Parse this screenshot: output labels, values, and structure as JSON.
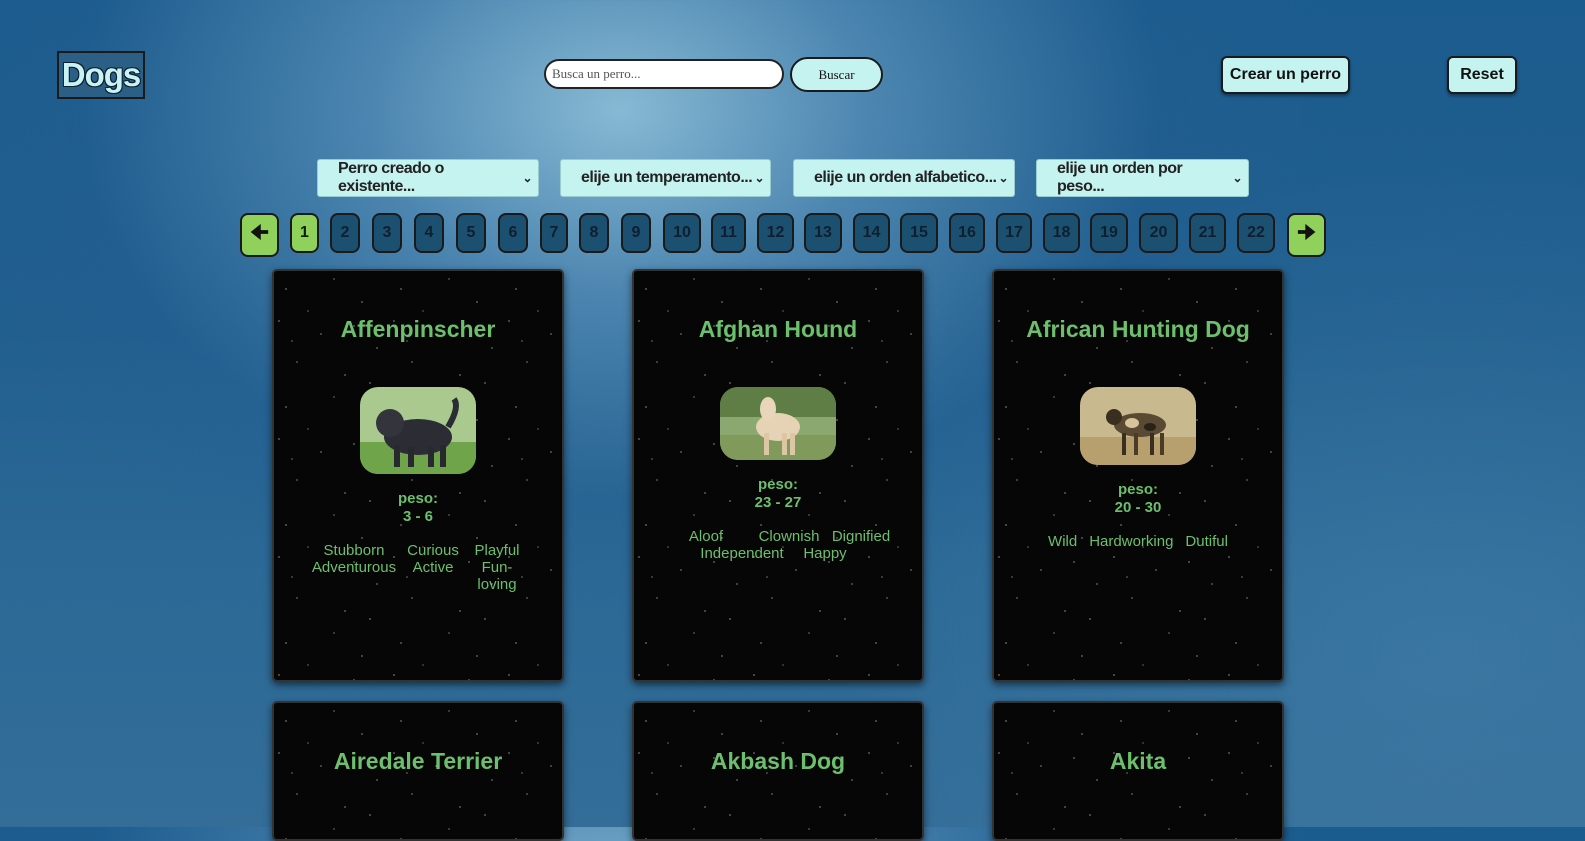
{
  "header": {
    "logo": "Dogs",
    "search_placeholder": "Busca un perro...",
    "search_button": "Buscar",
    "create_button": "Crear un perro",
    "reset_button": "Reset"
  },
  "filters": {
    "origin": "Perro creado o existente...",
    "temperament": "elije un temperamento...",
    "alpha_order": "elije un orden alfabetico...",
    "weight_order": "elije un orden por peso..."
  },
  "pagination": {
    "prev_icon": "arrow-left-icon",
    "next_icon": "arrow-right-icon",
    "pages": [
      "1",
      "2",
      "3",
      "4",
      "5",
      "6",
      "7",
      "8",
      "9",
      "10",
      "11",
      "12",
      "13",
      "14",
      "15",
      "16",
      "17",
      "18",
      "19",
      "20",
      "21",
      "22"
    ],
    "current": "1"
  },
  "cards": [
    {
      "name": "Affenpinscher",
      "peso_label": "peso:",
      "peso": "3 - 6",
      "temperaments": [
        "Stubborn",
        "Curious",
        "Playful",
        "Adventurous",
        "Active",
        "Fun-loving"
      ]
    },
    {
      "name": "Afghan Hound",
      "peso_label": "peso:",
      "peso": "23 - 27",
      "temperaments": [
        "Aloof",
        "Clownish",
        "Dignified",
        "Independent",
        "Happy"
      ]
    },
    {
      "name": "African Hunting Dog",
      "peso_label": "peso:",
      "peso": "20 - 30",
      "temperaments": [
        "Wild",
        "Hardworking",
        "Dutiful"
      ]
    },
    {
      "name": "Airedale Terrier"
    },
    {
      "name": "Akbash Dog"
    },
    {
      "name": "Akita"
    }
  ],
  "colors": {
    "accent_green": "#8fd15a",
    "title_green": "#6cbf6c",
    "button_bg": "#c5f3f0"
  }
}
